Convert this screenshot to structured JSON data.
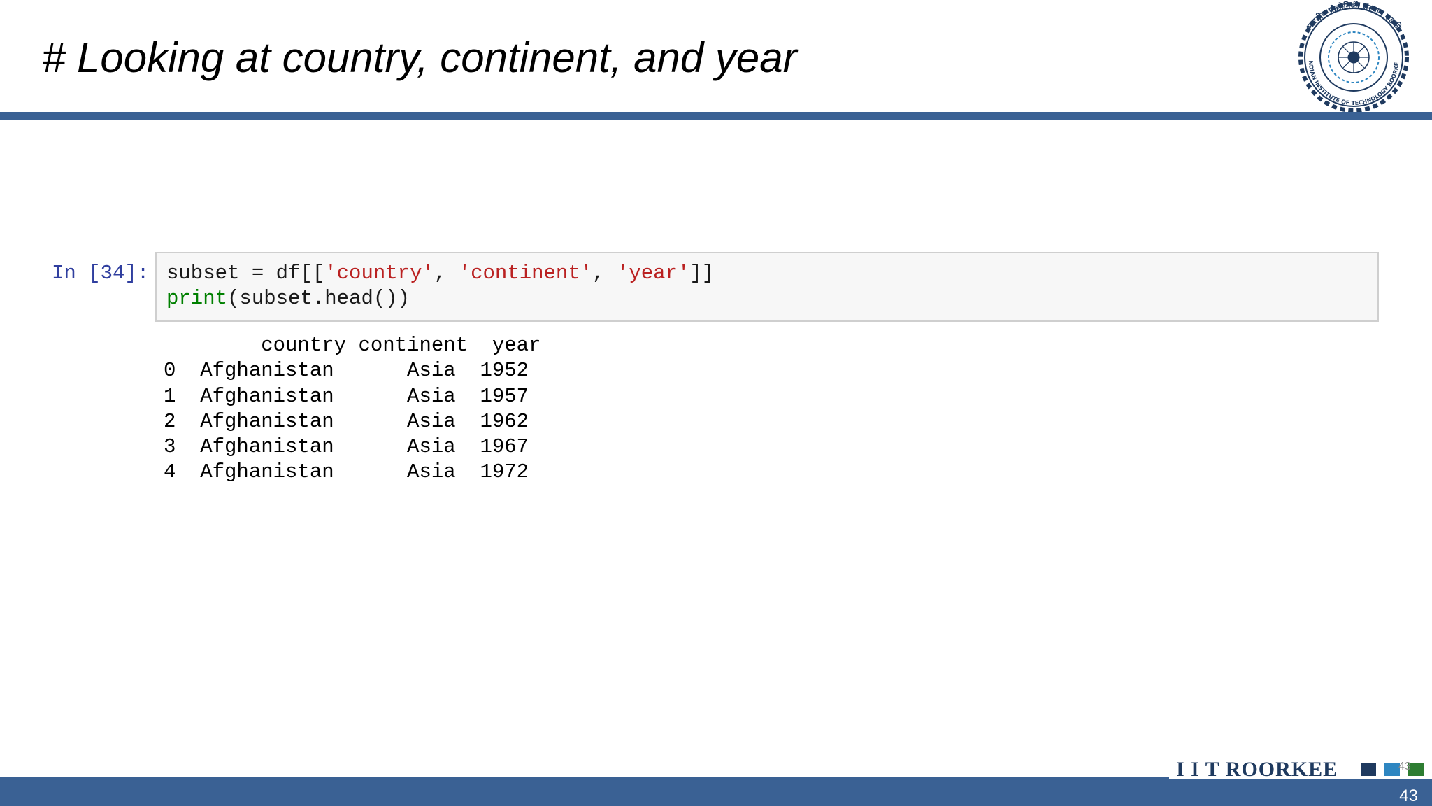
{
  "slide": {
    "title": "# Looking at country, continent, and year",
    "page_number": "43",
    "page_number_small": "43",
    "brand_text": "I I T ROORKEE"
  },
  "logo": {
    "outer_text": "भारतीय प्रौद्योगिकी संस्थान रुड़की",
    "inner_text": "INDIAN INSTITUTE OF TECHNOLOGY ROORKEE"
  },
  "cell": {
    "prompt": "In [34]:",
    "code_line1": {
      "p1": "subset = df[[",
      "s1": "'country'",
      "p2": ", ",
      "s2": "'continent'",
      "p3": ", ",
      "s3": "'year'",
      "p4": "]]"
    },
    "code_line2": {
      "builtin": "print",
      "rest": "(subset.head())"
    },
    "output": "        country continent  year\n0  Afghanistan      Asia  1952\n1  Afghanistan      Asia  1957\n2  Afghanistan      Asia  1962\n3  Afghanistan      Asia  1967\n4  Afghanistan      Asia  1972"
  },
  "colors": {
    "brand_blue": "#3a6194",
    "brand_dark": "#1f3a5f",
    "square_light": "#2e86c1",
    "square_green": "#2e7d32"
  },
  "icons": {
    "logo": "iit-roorkee-emblem-icon",
    "brand_squares": "brand-squares-icon"
  }
}
